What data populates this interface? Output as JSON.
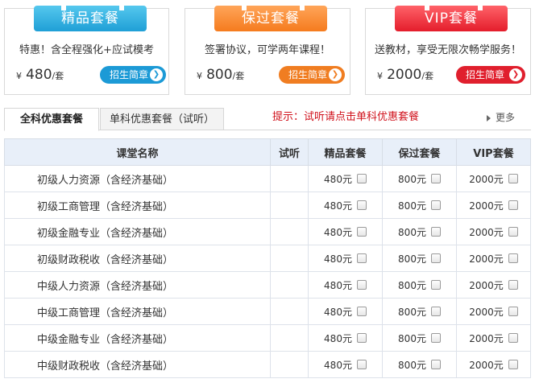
{
  "cards": [
    {
      "ribbon": "精品套餐",
      "desc": "特惠！含全程强化+应试模考",
      "currency": "¥",
      "price": "480",
      "unit": "/套",
      "cta": "招生简章",
      "accent": "#1c9ad6"
    },
    {
      "ribbon": "保过套餐",
      "desc": "签署协议，可学两年课程！",
      "currency": "¥",
      "price": "800",
      "unit": "/套",
      "cta": "招生简章",
      "accent": "#f07d21"
    },
    {
      "ribbon": "VIP套餐",
      "desc": "送教材，享受无限次畅学服务！",
      "currency": "¥",
      "price": "2000",
      "unit": "/套",
      "cta": "招生简章",
      "accent": "#e01f2d"
    }
  ],
  "tabs": {
    "active": "全科优惠套餐",
    "inactive": "单科优惠套餐（试听）"
  },
  "hint": "提示：试听请点击单科优惠套餐",
  "more": "更多",
  "table": {
    "headers": [
      "课堂名称",
      "试听",
      "精品套餐",
      "保过套餐",
      "VIP套餐"
    ],
    "rows": [
      {
        "name": "初级人力资源（含经济基础）",
        "p1": "480元",
        "p2": "800元",
        "p3": "2000元"
      },
      {
        "name": "初级工商管理（含经济基础）",
        "p1": "480元",
        "p2": "800元",
        "p3": "2000元"
      },
      {
        "name": "初级金融专业（含经济基础）",
        "p1": "480元",
        "p2": "800元",
        "p3": "2000元"
      },
      {
        "name": "初级财政税收（含经济基础）",
        "p1": "480元",
        "p2": "800元",
        "p3": "2000元"
      },
      {
        "name": "中级人力资源（含经济基础）",
        "p1": "480元",
        "p2": "800元",
        "p3": "2000元"
      },
      {
        "name": "中级工商管理（含经济基础）",
        "p1": "480元",
        "p2": "800元",
        "p3": "2000元"
      },
      {
        "name": "中级金融专业（含经济基础）",
        "p1": "480元",
        "p2": "800元",
        "p3": "2000元"
      },
      {
        "name": "中级财政税收（含经济基础）",
        "p1": "480元",
        "p2": "800元",
        "p3": "2000元"
      }
    ]
  }
}
